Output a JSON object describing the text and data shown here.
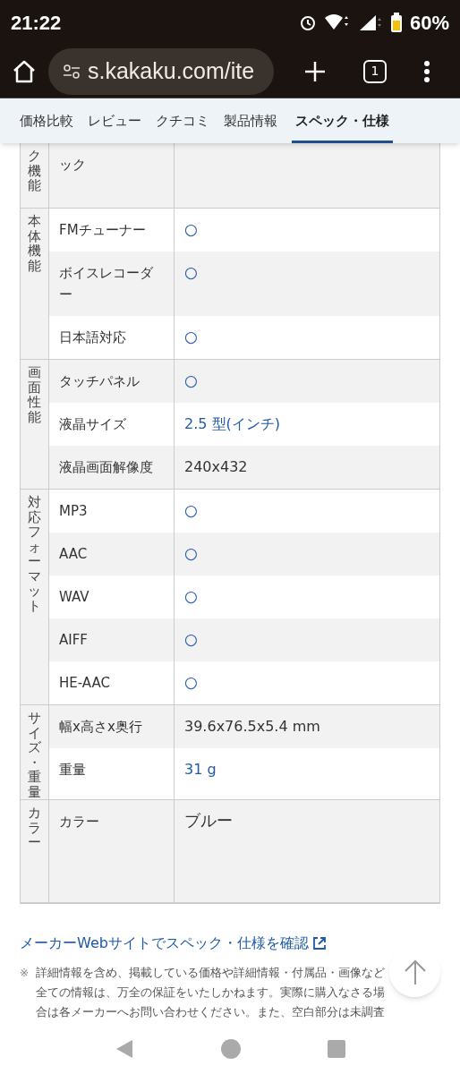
{
  "status_bar": {
    "time": "21:22",
    "battery": "60%"
  },
  "browser": {
    "url": "s.kakaku.com/ite",
    "tab_count": "1"
  },
  "tabs": [
    {
      "label": "価格比較",
      "selected": false
    },
    {
      "label": "レビュー",
      "selected": false
    },
    {
      "label": "クチコミ",
      "selected": false
    },
    {
      "label": "製品情報",
      "selected": false
    },
    {
      "label": "スペック・仕様",
      "selected": true
    }
  ],
  "spec_table": {
    "groups": [
      {
        "label": "ク機能",
        "rows": [
          {
            "label": "ック",
            "value": ""
          }
        ]
      },
      {
        "label": "本体機能",
        "rows": [
          {
            "label": "FMチューナー",
            "value": "○",
            "kind": "mark"
          },
          {
            "label": "ボイスレコーダー",
            "value": "○",
            "kind": "mark"
          },
          {
            "label": "日本語対応",
            "value": "○",
            "kind": "mark"
          }
        ]
      },
      {
        "label": "画面性能",
        "rows": [
          {
            "label": "タッチパネル",
            "value": "○",
            "kind": "mark"
          },
          {
            "label": "液晶サイズ",
            "value": "2.5 型(インチ)",
            "kind": "link"
          },
          {
            "label": "液晶画面解像度",
            "value": "240x432",
            "kind": "text"
          }
        ]
      },
      {
        "label": "対応フォーマット",
        "rows": [
          {
            "label": "MP3",
            "value": "○",
            "kind": "mark"
          },
          {
            "label": "AAC",
            "value": "○",
            "kind": "mark"
          },
          {
            "label": "WAV",
            "value": "○",
            "kind": "mark"
          },
          {
            "label": "AIFF",
            "value": "○",
            "kind": "mark"
          },
          {
            "label": "HE-AAC",
            "value": "○",
            "kind": "mark"
          }
        ]
      },
      {
        "label": "サイズ・重量",
        "rows": [
          {
            "label": "幅x高さx奥行",
            "value": "39.6x76.5x5.4 mm",
            "kind": "text"
          },
          {
            "label": "重量",
            "value": "31 g",
            "kind": "link"
          }
        ]
      },
      {
        "label": "カラー",
        "rows": [
          {
            "label": "カラー",
            "value": "ブルー",
            "kind": "large"
          }
        ]
      }
    ]
  },
  "maker_link": "メーカーWebサイトでスペック・仕様を確認",
  "footnote": {
    "mark": "※",
    "lines": [
      "詳細情報を含め、掲載している価格や詳細情報・付属品・画像など",
      "全ての情報は、万全の保証をいたしかねます。実際に購入なさる場",
      "合は各メーカーへお問い合わせください。また、空白部分は未調査"
    ]
  }
}
